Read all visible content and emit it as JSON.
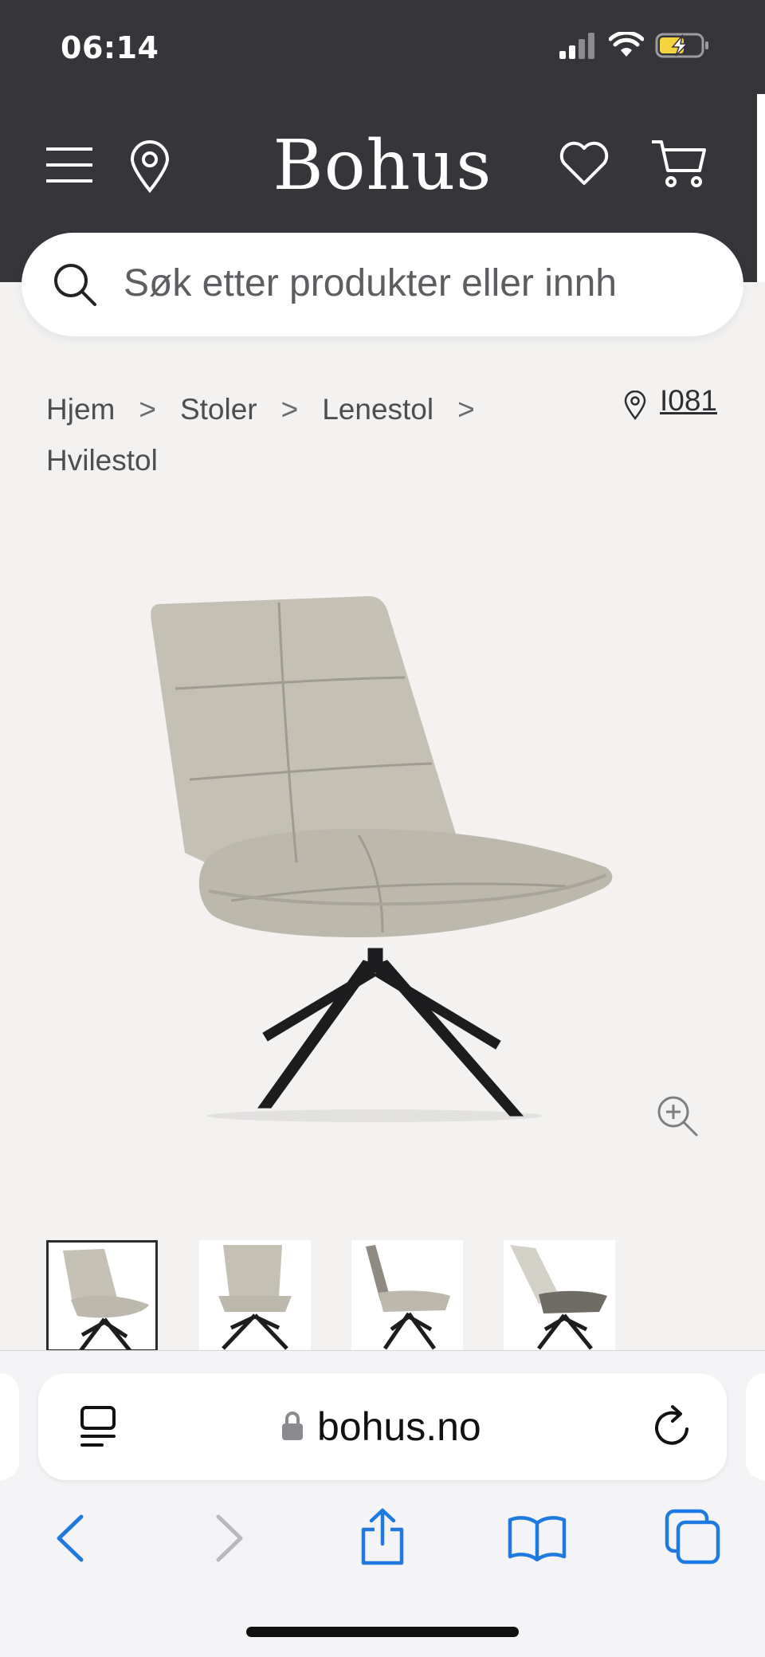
{
  "status_bar": {
    "time": "06:14"
  },
  "header": {
    "logo": "Bohus"
  },
  "search": {
    "placeholder": "Søk etter produkter eller innh"
  },
  "breadcrumb": {
    "items": [
      "Hjem",
      "Stoler",
      "Lenestol",
      "Hvilestol"
    ],
    "separator": ">"
  },
  "store": {
    "code": "I081"
  },
  "gallery": {
    "thumbnail_count": 4,
    "active_index": 0
  },
  "browser": {
    "url": "bohus.no"
  },
  "colors": {
    "header_bg": "#35353a",
    "page_bg": "#f3f2f1",
    "safari_blue": "#1f7ae0"
  }
}
